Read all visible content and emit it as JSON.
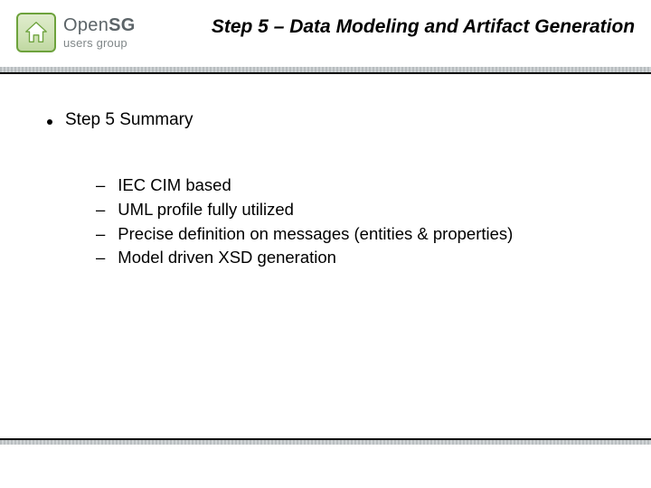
{
  "logo": {
    "line1_prefix": "Open",
    "line1_bold": "SG",
    "line2": "users group"
  },
  "title": "Step 5 – Data Modeling and Artifact Generation",
  "summary_label": "Step 5 Summary",
  "items": [
    "IEC CIM based",
    "UML profile fully utilized",
    "Precise definition on messages (entities & properties)",
    "Model driven XSD generation"
  ]
}
